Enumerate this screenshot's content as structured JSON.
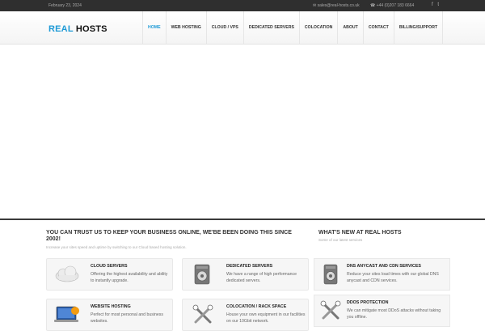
{
  "topbar": {
    "date": "February 23, 2024",
    "email": "sales@real-hosts.co.uk",
    "phone": "+44 (0)207 183 6664",
    "social": [
      "f",
      "t"
    ]
  },
  "logo": {
    "part1": "REAL",
    "part2": "HOSTS"
  },
  "nav": {
    "items": [
      "HOME",
      "WEB HOSTING",
      "CLOUD / VPS",
      "DEDICATED SERVERS",
      "COLOCATION",
      "ABOUT",
      "CONTACT",
      "BILLING/SUPPORT"
    ],
    "active": "HOME"
  },
  "main": {
    "title": "YOU CAN TRUST US TO KEEP YOUR BUSINESS ONLINE, WE'BE BEEN DOING THIS SINCE 2002!",
    "subtitle": "Increase your sites speed and uptime by switching to our Cloud based hosting solution.",
    "services": [
      {
        "title": "CLOUD SERVERS",
        "text": "Offering the highest availability and ability to instantly upgrade.",
        "icon": "cloud-icon"
      },
      {
        "title": "DEDICATED SERVERS",
        "text": "We have a range of high performance dedicated servers.",
        "icon": "server-icon"
      },
      {
        "title": "WEBSITE HOSTING",
        "text": "Perfect for most personal and business websites.",
        "icon": "laptop-icon"
      },
      {
        "title": "COLOCATION / RACK SPACE",
        "text": "House your own equipment in our facilities on our 10Gbit network.",
        "icon": "tools-icon"
      }
    ]
  },
  "news": {
    "title": "WHAT'S NEW AT REAL HOSTS",
    "subtitle": "Some of our latest services",
    "items": [
      {
        "title": "DNS ANYCAST AND CDN SERVICES",
        "text": "Reduce your sites load times with our global DNS anycast and CDN services.",
        "icon": "server-icon"
      },
      {
        "title": "DDOS PROTECTION",
        "text": "We can mitigate most DDoS attacks without taking you offline.",
        "icon": "tools-icon"
      }
    ]
  },
  "colors": {
    "accent": "#1e9ad6",
    "topbar": "#2f2f2f",
    "divider": "#3b3b3b"
  }
}
